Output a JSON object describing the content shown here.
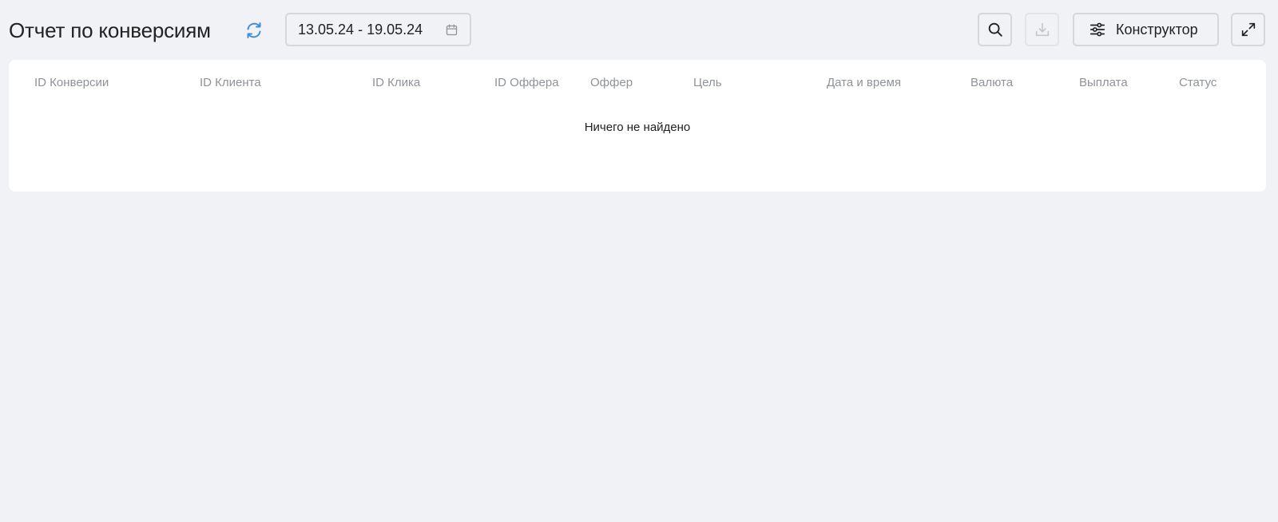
{
  "header": {
    "title": "Отчет по конверсиям",
    "date_range": "13.05.24 - 19.05.24",
    "constructor_label": "Конструктор"
  },
  "icons": {
    "refresh": "refresh-icon",
    "calendar": "calendar-icon",
    "search": "search-icon",
    "download": "download-icon",
    "sliders": "sliders-icon",
    "expand": "expand-icon"
  },
  "table": {
    "columns": [
      "ID Конверсии",
      "ID Клиента",
      "ID Клика",
      "ID Оффера",
      "Оффер",
      "Цель",
      "Дата и время",
      "Валюта",
      "Выплата",
      "Статус"
    ],
    "empty_message": "Ничего не найдено"
  },
  "colors": {
    "background": "#f1f2f6",
    "card": "#ffffff",
    "accent": "#3b8fd9",
    "muted_text": "#8f9298",
    "border": "#d6d7dc"
  }
}
